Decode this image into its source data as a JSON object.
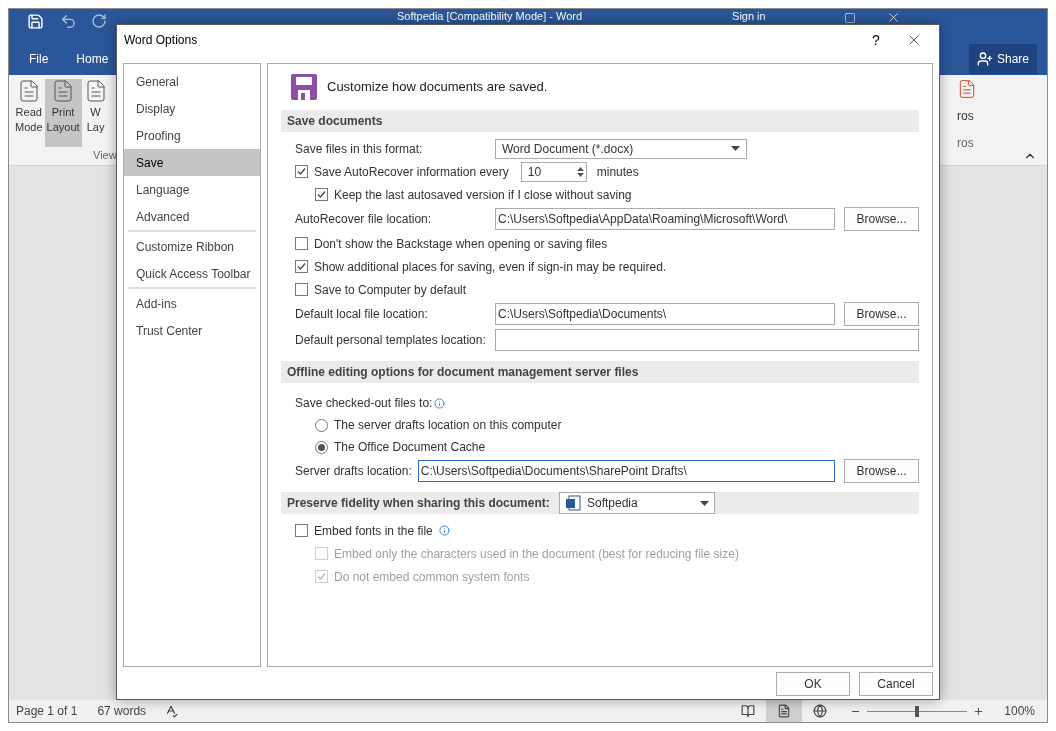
{
  "word_window": {
    "title": "Softpedia [Compatibility Mode] - Word",
    "sign_in": "Sign in",
    "tabs": [
      {
        "label": "File"
      },
      {
        "label": "Home"
      }
    ],
    "share_button": "Share",
    "ribbon": {
      "buttons": [
        {
          "lines": [
            "Read",
            "Mode"
          ],
          "selected": false
        },
        {
          "lines": [
            "Print",
            "Layout"
          ],
          "selected": true
        },
        {
          "lines": [
            "W",
            "Lay"
          ],
          "selected": false
        }
      ],
      "group_label": "View",
      "right_button": "ros",
      "right_group_label": "ros"
    },
    "status_bar": {
      "page": "Page 1 of 1",
      "words": "67 words",
      "views": [
        {
          "selected": false
        },
        {
          "selected": true
        },
        {
          "selected": false
        }
      ],
      "zoom": {
        "level": 0.5,
        "reading": "100%"
      }
    }
  },
  "dialog": {
    "title": "Word Options",
    "help": "?",
    "nav": [
      [
        {
          "label": "General",
          "selected": false
        },
        {
          "label": "Display",
          "selected": false
        },
        {
          "label": "Proofing",
          "selected": false
        },
        {
          "label": "Save",
          "selected": true
        },
        {
          "label": "Language",
          "selected": false
        },
        {
          "label": "Advanced",
          "selected": false
        }
      ],
      [
        {
          "label": "Customize Ribbon",
          "selected": false
        },
        {
          "label": "Quick Access Toolbar",
          "selected": false
        }
      ],
      [
        {
          "label": "Add-ins",
          "selected": false
        },
        {
          "label": "Trust Center",
          "selected": false
        }
      ]
    ],
    "heading": "Customize how documents are saved.",
    "sections": [
      {
        "title": "Save documents",
        "rows": [
          {
            "kind": "select",
            "label": "Save files in this format:",
            "value": "Word Document (*.docx)"
          },
          {
            "kind": "checkbox",
            "label": "Save AutoRecover information every",
            "checked": true,
            "disabled": false,
            "spinner": {
              "value": "10",
              "unit": "minutes"
            },
            "children": [
              {
                "kind": "checkbox",
                "label": "Keep the last autosaved version if I close without saving",
                "checked": true,
                "disabled": false
              }
            ]
          },
          {
            "kind": "path",
            "label": "AutoRecover file location:",
            "value": "C:\\Users\\Softpedia\\AppData\\Roaming\\Microsoft\\Word\\",
            "button": "Browse...",
            "focused": false
          },
          {
            "kind": "checkbox",
            "label": "Don't show the Backstage when opening or saving files",
            "checked": false,
            "disabled": false
          },
          {
            "kind": "checkbox",
            "label": "Show additional places for saving, even if sign-in may be required.",
            "checked": true,
            "disabled": false
          },
          {
            "kind": "checkbox",
            "label": "Save to Computer by default",
            "checked": false,
            "disabled": false
          },
          {
            "kind": "path",
            "label": "Default local file location:",
            "value": "C:\\Users\\Softpedia\\Documents\\",
            "button": "Browse...",
            "focused": false
          },
          {
            "kind": "path",
            "label": "Default personal templates location:",
            "focused": false
          }
        ]
      },
      {
        "title": "Offline editing options for document management server files",
        "rows": [
          {
            "kind": "label",
            "label": "Save checked-out files to:",
            "info": true,
            "children": [
              {
                "kind": "radio",
                "label": "The server drafts location on this computer",
                "selected": false
              },
              {
                "kind": "radio",
                "label": "The Office Document Cache",
                "selected": true
              }
            ]
          },
          {
            "kind": "path",
            "label": "Server drafts location:",
            "value": "C:\\Users\\Softpedia\\Documents\\SharePoint Drafts\\",
            "button": "Browse...",
            "focused": true
          }
        ]
      },
      {
        "title": "Preserve fidelity when sharing this document:",
        "select": "Softpedia",
        "rows": [
          {
            "kind": "checkbox",
            "label": "Embed fonts in the file",
            "checked": false,
            "disabled": false,
            "info": true,
            "children": [
              {
                "kind": "checkbox",
                "label": "Embed only the characters used in the document (best for reducing file size)",
                "checked": false,
                "disabled": true
              },
              {
                "kind": "checkbox",
                "label": "Do not embed common system fonts",
                "checked": true,
                "disabled": true
              }
            ]
          }
        ]
      }
    ],
    "buttons": [
      "OK",
      "Cancel"
    ]
  }
}
